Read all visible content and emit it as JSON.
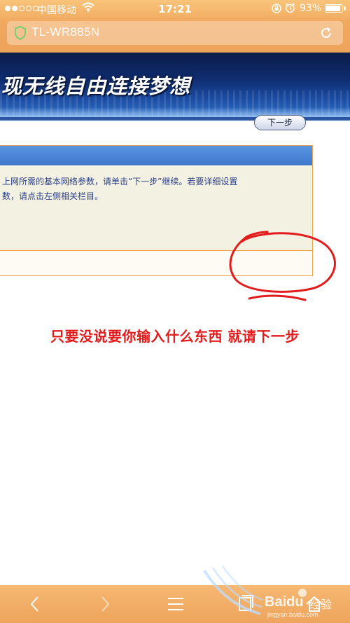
{
  "status_bar": {
    "carrier": "中国移动",
    "time": "17:21",
    "battery": "93%",
    "battery_level": 0.93,
    "signal_bars_filled": 2,
    "signal_bars_total": 5
  },
  "browser": {
    "url_title": "TL-WR885N"
  },
  "banner": {
    "text": "现无线自由连接梦想"
  },
  "setup_panel": {
    "line1": "上网所需的基本网络参数，请单击“下一步”继续。若要详细设置",
    "line2": "数，请点击左侧相关栏目。",
    "next_label": "下一步"
  },
  "annotation": {
    "text": "只要没说要你输入什么东西 就请下一步",
    "color": "#e21c1c"
  },
  "toolbar": {
    "icons": [
      "back-icon",
      "forward-icon",
      "menu-icon",
      "tabs-icon",
      "home-icon"
    ]
  },
  "watermark": {
    "brand": "Baidu",
    "brand_cn": "经验",
    "url": "jingyan.baidu.com"
  },
  "colors": {
    "browser_chrome": "#f0a85e",
    "banner": "#0f2c6e",
    "panel_header": "#3f76cc",
    "panel_border": "#f0a24a",
    "panel_text": "#2a3f86"
  }
}
